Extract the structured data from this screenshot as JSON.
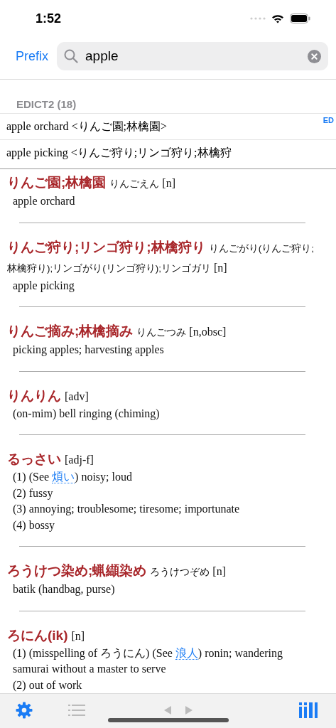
{
  "status_bar": {
    "time": "1:52"
  },
  "search_bar": {
    "prefix_button": "Prefix",
    "value": "apple"
  },
  "results": {
    "header": "EDICT2 (18)",
    "index_label": "ED",
    "rows": [
      {
        "text": "apple orchard <りんご園;林檎園>"
      },
      {
        "text": "apple picking <りんご狩り;リンゴ狩り;林檎狩"
      }
    ]
  },
  "entries": [
    {
      "headword": "りんご園;林檎園",
      "reading": "りんごえん",
      "tags": "[n]",
      "senses": [
        [
          {
            "kind": "text",
            "text": "apple orchard"
          }
        ]
      ]
    },
    {
      "headword": "りんご狩り;リンゴ狩り;林檎狩り",
      "reading": "りんごがり(りんご狩り;林檎狩り);リンゴがり(リンゴ狩り);リンゴガリ",
      "tags": "[n]",
      "senses": [
        [
          {
            "kind": "text",
            "text": "apple picking"
          }
        ]
      ]
    },
    {
      "headword": "りんご摘み;林檎摘み",
      "reading": "りんごつみ",
      "tags": "[n,obsc]",
      "senses": [
        [
          {
            "kind": "text",
            "text": "picking apples; harvesting apples"
          }
        ]
      ]
    },
    {
      "headword": "りんりん",
      "tags": "[adv]",
      "senses": [
        [
          {
            "kind": "text",
            "text": "(on-mim) bell ringing (chiming)"
          }
        ]
      ]
    },
    {
      "headword": "るっさい",
      "tags": "[adj-f]",
      "senses": [
        [
          {
            "kind": "text",
            "text": "(1) (See "
          },
          {
            "kind": "link",
            "text": "煩い"
          },
          {
            "kind": "text",
            "text": ") noisy; loud"
          }
        ],
        [
          {
            "kind": "text",
            "text": "(2) fussy"
          }
        ],
        [
          {
            "kind": "text",
            "text": "(3) annoying; troublesome; tiresome; importunate"
          }
        ],
        [
          {
            "kind": "text",
            "text": "(4) bossy"
          }
        ]
      ]
    },
    {
      "headword": "ろうけつ染め;蝋纈染め",
      "reading": "ろうけつぞめ",
      "tags": "[n]",
      "senses": [
        [
          {
            "kind": "text",
            "text": "batik (handbag, purse)"
          }
        ]
      ]
    },
    {
      "headword": "ろにん(ik)",
      "tags": "[n]",
      "senses": [
        [
          {
            "kind": "text",
            "text": "(1) (misspelling of ろうにん) (See "
          },
          {
            "kind": "link",
            "text": "浪人"
          },
          {
            "kind": "text",
            "text": ") ronin; wandering samurai without a master to serve"
          }
        ],
        [
          {
            "kind": "text",
            "text": "(2) out of work"
          }
        ]
      ]
    }
  ],
  "toolbar": {
    "list_disabled": true,
    "history_disabled": true
  }
}
